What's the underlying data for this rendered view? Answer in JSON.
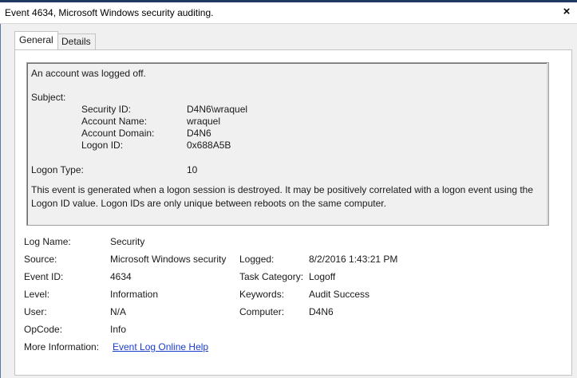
{
  "window": {
    "title": "Event 4634, Microsoft Windows security auditing.",
    "close": "×"
  },
  "tabs": [
    {
      "label": "General"
    },
    {
      "label": "Details"
    }
  ],
  "message": {
    "summary": "An account was logged off.",
    "subject_label": "Subject:",
    "subject": [
      {
        "label": "Security ID:",
        "value": "D4N6\\wraquel"
      },
      {
        "label": "Account Name:",
        "value": "wraquel"
      },
      {
        "label": "Account Domain:",
        "value": "D4N6"
      },
      {
        "label": "Logon ID:",
        "value": "0x688A5B"
      }
    ],
    "logon_type_label": "Logon Type:",
    "logon_type_value": "10",
    "description": "This event is generated when a logon session is destroyed. It may be positively correlated with a logon event using the Logon ID value. Logon IDs are only unique between reboots on the same computer."
  },
  "details": {
    "log_name": {
      "label": "Log Name:",
      "value": "Security"
    },
    "source": {
      "label": "Source:",
      "value": "Microsoft Windows security"
    },
    "logged": {
      "label": "Logged:",
      "value": "8/2/2016 1:43:21 PM"
    },
    "event_id": {
      "label": "Event ID:",
      "value": "4634"
    },
    "task_category": {
      "label": "Task Category:",
      "value": "Logoff"
    },
    "level": {
      "label": "Level:",
      "value": "Information"
    },
    "keywords": {
      "label": "Keywords:",
      "value": "Audit Success"
    },
    "user": {
      "label": "User:",
      "value": "N/A"
    },
    "computer": {
      "label": "Computer:",
      "value": "D4N6"
    },
    "opcode": {
      "label": "OpCode:",
      "value": "Info"
    },
    "more_info": {
      "label": "More Information:",
      "link": "Event Log Online Help"
    }
  }
}
